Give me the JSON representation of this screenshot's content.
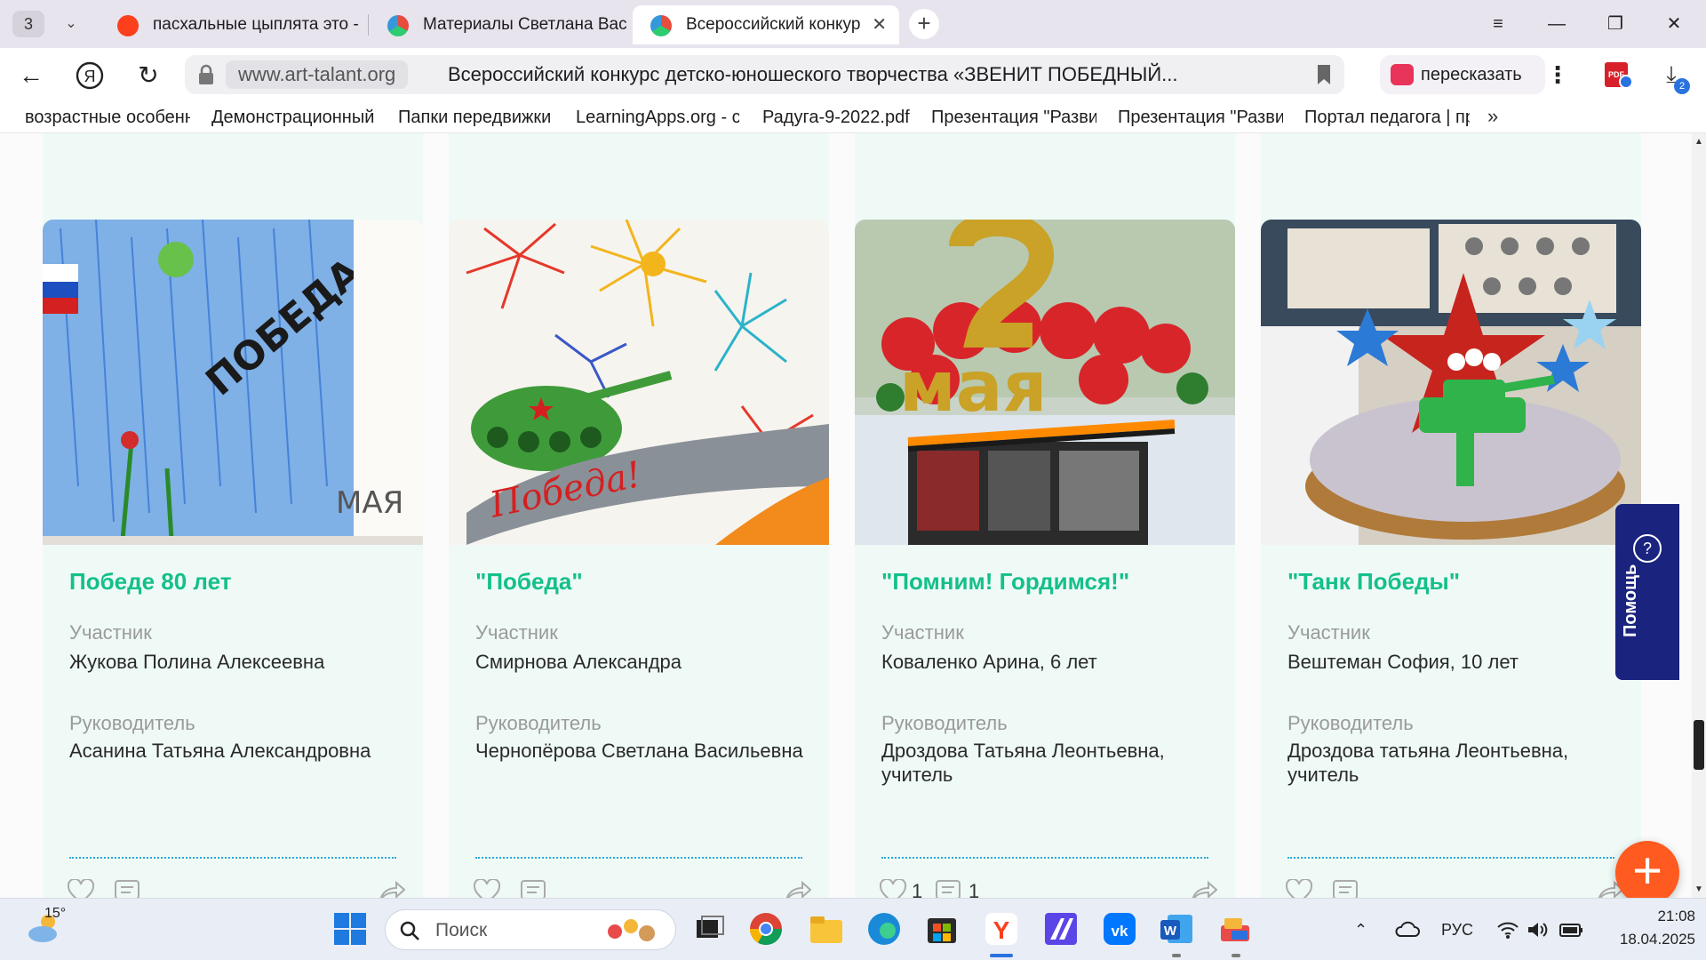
{
  "tabs": {
    "count": "3",
    "items": [
      {
        "label": "пасхальные цыплята это -",
        "active": false
      },
      {
        "label": "Материалы Светлана Вас",
        "active": false
      },
      {
        "label": "Всероссийский конкур",
        "active": true
      }
    ]
  },
  "window_controls": {
    "menu": "≡",
    "minimize": "—",
    "restore": "❐",
    "close": "✕"
  },
  "address": {
    "domain": "www.art-talant.org",
    "title": "Всероссийский конкурс детско-юношеского творчества «ЗВЕНИТ ПОБЕДНЫЙ..."
  },
  "toolbar": {
    "retell_label": "пересказать",
    "downloads_badge": "2"
  },
  "bookmarks": [
    "возрастные особенн",
    "Демонстрационный",
    "Папки передвижки",
    "LearningApps.org - с",
    "Радуга-9-2022.pdf",
    "Презентация \"Разви",
    "Презентация \"Разви",
    "Портал педагога | пр"
  ],
  "bookmarks_more": "»",
  "cards": [
    {
      "title": "Победе 80 лет",
      "participant_label": "Участник",
      "participant": "Жукова Полина Алексеевна",
      "supervisor_label": "Руководитель",
      "supervisor": "Асанина Татьяна Александровна",
      "likes": "",
      "comments": ""
    },
    {
      "title": "\"Победа\"",
      "participant_label": "Участник",
      "participant": "Смирнова Александра",
      "supervisor_label": "Руководитель",
      "supervisor": "Чернопёрова Светлана Васильевна",
      "likes": "",
      "comments": ""
    },
    {
      "title": "\"Помним! Гордимся!\"",
      "participant_label": "Участник",
      "participant": "Коваленко Арина, 6 лет",
      "supervisor_label": "Руководитель",
      "supervisor": "Дроздова Татьяна Леонтьевна, учитель",
      "likes": "1",
      "comments": "1"
    },
    {
      "title": "\"Танк Победы\"",
      "participant_label": "Участник",
      "participant": "Вештеман София, 10 лет",
      "supervisor_label": "Руководитель",
      "supervisor": "Дроздова татьяна Леонтьевна, учитель",
      "likes": "",
      "comments": ""
    }
  ],
  "help": {
    "label": "Помощь",
    "icon": "?"
  },
  "fab": {
    "icon": "+"
  },
  "taskbar": {
    "weather_temp": "15°",
    "search_placeholder": "Поиск",
    "language": "РУС",
    "time": "21:08",
    "date": "18.04.2025"
  },
  "colors": {
    "accent_green": "#14c08a",
    "card_bg": "#effaf7",
    "help_bg": "#1a237e",
    "fab_bg": "#ff5a1f",
    "divider": "#2aa8d8"
  }
}
